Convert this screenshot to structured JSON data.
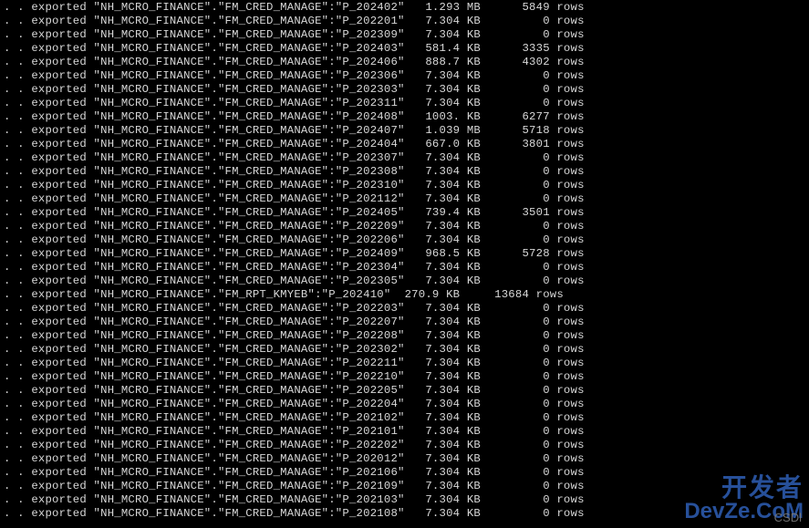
{
  "terminal": {
    "prefix": ". . exported ",
    "rows_label": "rows",
    "lines": [
      {
        "name": "\"NH_MCRO_FINANCE\".\"FM_CRED_MANAGE\":\"P_202402\"",
        "size": "1.293 MB",
        "rows": 5849
      },
      {
        "name": "\"NH_MCRO_FINANCE\".\"FM_CRED_MANAGE\":\"P_202201\"",
        "size": "7.304 KB",
        "rows": 0
      },
      {
        "name": "\"NH_MCRO_FINANCE\".\"FM_CRED_MANAGE\":\"P_202309\"",
        "size": "7.304 KB",
        "rows": 0
      },
      {
        "name": "\"NH_MCRO_FINANCE\".\"FM_CRED_MANAGE\":\"P_202403\"",
        "size": "581.4 KB",
        "rows": 3335
      },
      {
        "name": "\"NH_MCRO_FINANCE\".\"FM_CRED_MANAGE\":\"P_202406\"",
        "size": "888.7 KB",
        "rows": 4302
      },
      {
        "name": "\"NH_MCRO_FINANCE\".\"FM_CRED_MANAGE\":\"P_202306\"",
        "size": "7.304 KB",
        "rows": 0
      },
      {
        "name": "\"NH_MCRO_FINANCE\".\"FM_CRED_MANAGE\":\"P_202303\"",
        "size": "7.304 KB",
        "rows": 0
      },
      {
        "name": "\"NH_MCRO_FINANCE\".\"FM_CRED_MANAGE\":\"P_202311\"",
        "size": "7.304 KB",
        "rows": 0
      },
      {
        "name": "\"NH_MCRO_FINANCE\".\"FM_CRED_MANAGE\":\"P_202408\"",
        "size": "1003. KB",
        "rows": 6277
      },
      {
        "name": "\"NH_MCRO_FINANCE\".\"FM_CRED_MANAGE\":\"P_202407\"",
        "size": "1.039 MB",
        "rows": 5718
      },
      {
        "name": "\"NH_MCRO_FINANCE\".\"FM_CRED_MANAGE\":\"P_202404\"",
        "size": "667.0 KB",
        "rows": 3801
      },
      {
        "name": "\"NH_MCRO_FINANCE\".\"FM_CRED_MANAGE\":\"P_202307\"",
        "size": "7.304 KB",
        "rows": 0
      },
      {
        "name": "\"NH_MCRO_FINANCE\".\"FM_CRED_MANAGE\":\"P_202308\"",
        "size": "7.304 KB",
        "rows": 0
      },
      {
        "name": "\"NH_MCRO_FINANCE\".\"FM_CRED_MANAGE\":\"P_202310\"",
        "size": "7.304 KB",
        "rows": 0
      },
      {
        "name": "\"NH_MCRO_FINANCE\".\"FM_CRED_MANAGE\":\"P_202112\"",
        "size": "7.304 KB",
        "rows": 0
      },
      {
        "name": "\"NH_MCRO_FINANCE\".\"FM_CRED_MANAGE\":\"P_202405\"",
        "size": "739.4 KB",
        "rows": 3501
      },
      {
        "name": "\"NH_MCRO_FINANCE\".\"FM_CRED_MANAGE\":\"P_202209\"",
        "size": "7.304 KB",
        "rows": 0
      },
      {
        "name": "\"NH_MCRO_FINANCE\".\"FM_CRED_MANAGE\":\"P_202206\"",
        "size": "7.304 KB",
        "rows": 0
      },
      {
        "name": "\"NH_MCRO_FINANCE\".\"FM_CRED_MANAGE\":\"P_202409\"",
        "size": "968.5 KB",
        "rows": 5728
      },
      {
        "name": "\"NH_MCRO_FINANCE\".\"FM_CRED_MANAGE\":\"P_202304\"",
        "size": "7.304 KB",
        "rows": 0
      },
      {
        "name": "\"NH_MCRO_FINANCE\".\"FM_CRED_MANAGE\":\"P_202305\"",
        "size": "7.304 KB",
        "rows": 0
      },
      {
        "name": "\"NH_MCRO_FINANCE\".\"FM_RPT_KMYEB\":\"P_202410\"",
        "size": "270.9 KB",
        "rows": 13684,
        "short": true
      },
      {
        "name": "\"NH_MCRO_FINANCE\".\"FM_CRED_MANAGE\":\"P_202203\"",
        "size": "7.304 KB",
        "rows": 0
      },
      {
        "name": "\"NH_MCRO_FINANCE\".\"FM_CRED_MANAGE\":\"P_202207\"",
        "size": "7.304 KB",
        "rows": 0
      },
      {
        "name": "\"NH_MCRO_FINANCE\".\"FM_CRED_MANAGE\":\"P_202208\"",
        "size": "7.304 KB",
        "rows": 0
      },
      {
        "name": "\"NH_MCRO_FINANCE\".\"FM_CRED_MANAGE\":\"P_202302\"",
        "size": "7.304 KB",
        "rows": 0
      },
      {
        "name": "\"NH_MCRO_FINANCE\".\"FM_CRED_MANAGE\":\"P_202211\"",
        "size": "7.304 KB",
        "rows": 0
      },
      {
        "name": "\"NH_MCRO_FINANCE\".\"FM_CRED_MANAGE\":\"P_202210\"",
        "size": "7.304 KB",
        "rows": 0
      },
      {
        "name": "\"NH_MCRO_FINANCE\".\"FM_CRED_MANAGE\":\"P_202205\"",
        "size": "7.304 KB",
        "rows": 0
      },
      {
        "name": "\"NH_MCRO_FINANCE\".\"FM_CRED_MANAGE\":\"P_202204\"",
        "size": "7.304 KB",
        "rows": 0
      },
      {
        "name": "\"NH_MCRO_FINANCE\".\"FM_CRED_MANAGE\":\"P_202102\"",
        "size": "7.304 KB",
        "rows": 0
      },
      {
        "name": "\"NH_MCRO_FINANCE\".\"FM_CRED_MANAGE\":\"P_202101\"",
        "size": "7.304 KB",
        "rows": 0
      },
      {
        "name": "\"NH_MCRO_FINANCE\".\"FM_CRED_MANAGE\":\"P_202202\"",
        "size": "7.304 KB",
        "rows": 0
      },
      {
        "name": "\"NH_MCRO_FINANCE\".\"FM_CRED_MANAGE\":\"P_202012\"",
        "size": "7.304 KB",
        "rows": 0
      },
      {
        "name": "\"NH_MCRO_FINANCE\".\"FM_CRED_MANAGE\":\"P_202106\"",
        "size": "7.304 KB",
        "rows": 0
      },
      {
        "name": "\"NH_MCRO_FINANCE\".\"FM_CRED_MANAGE\":\"P_202109\"",
        "size": "7.304 KB",
        "rows": 0
      },
      {
        "name": "\"NH_MCRO_FINANCE\".\"FM_CRED_MANAGE\":\"P_202103\"",
        "size": "7.304 KB",
        "rows": 0
      },
      {
        "name": "\"NH_MCRO_FINANCE\".\"FM_CRED_MANAGE\":\"P_202108\"",
        "size": "7.304 KB",
        "rows": 0
      }
    ]
  },
  "watermark": {
    "top_text": "开发者",
    "bottom_text": "DevZe.CoM",
    "csdn_label": "CSDl"
  }
}
